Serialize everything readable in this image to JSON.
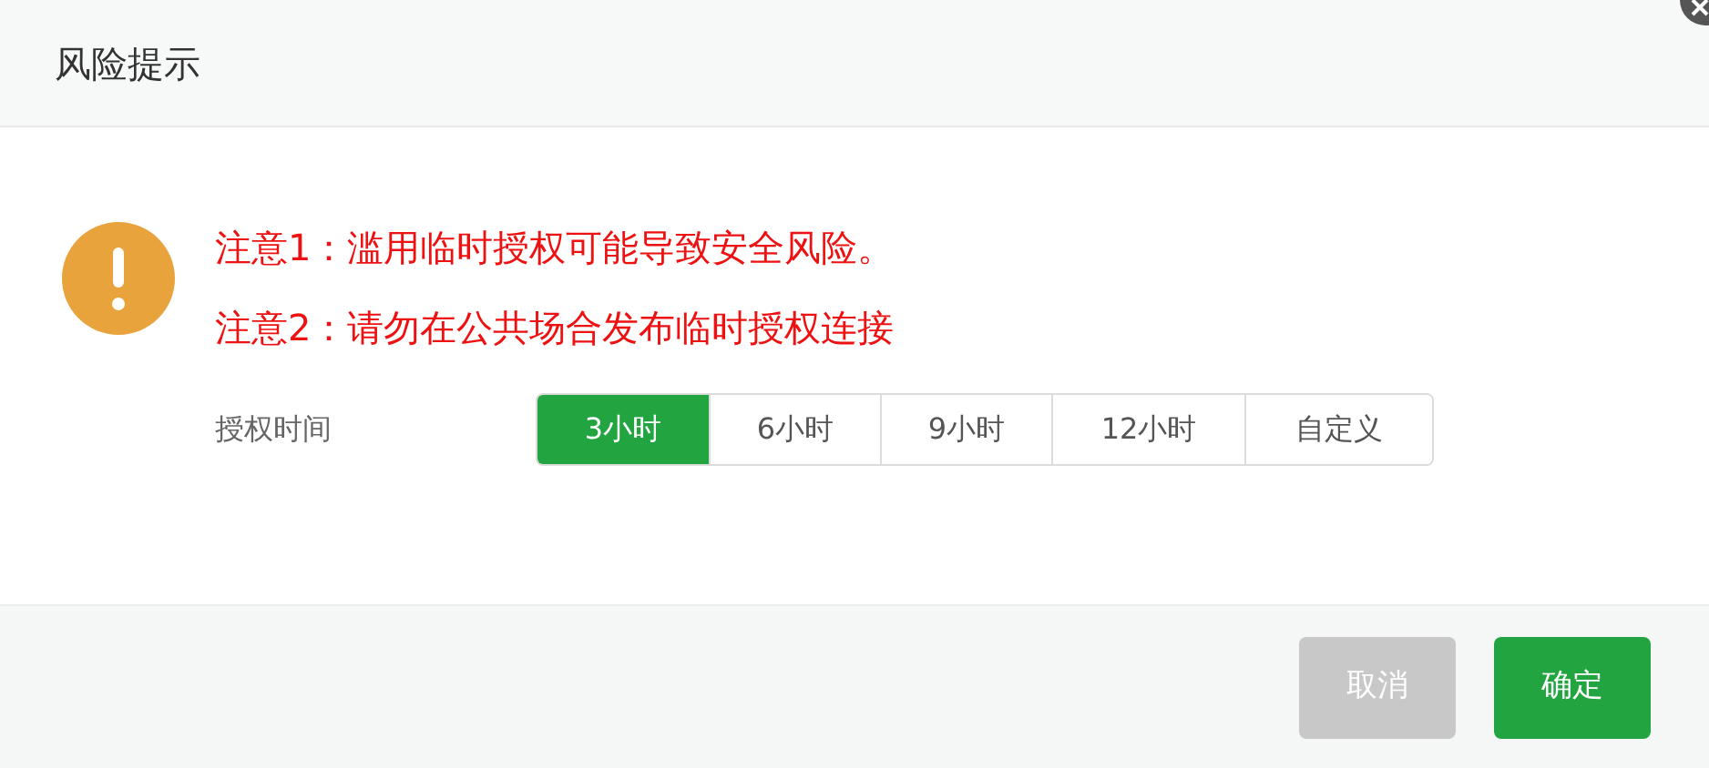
{
  "dialog": {
    "title": "风险提示"
  },
  "warnings": [
    "注意1：滥用临时授权可能导致安全风险。",
    "注意2：请勿在公共场合发布临时授权连接"
  ],
  "duration": {
    "label": "授权时间",
    "options": [
      {
        "label": "3小时",
        "selected": true
      },
      {
        "label": "6小时",
        "selected": false
      },
      {
        "label": "9小时",
        "selected": false
      },
      {
        "label": "12小时",
        "selected": false
      },
      {
        "label": "自定义",
        "selected": false
      }
    ]
  },
  "buttons": [
    {
      "label": "取消",
      "kind": "cancel",
      "disabled": true
    },
    {
      "label": "确定",
      "kind": "confirm",
      "disabled": false
    }
  ]
}
